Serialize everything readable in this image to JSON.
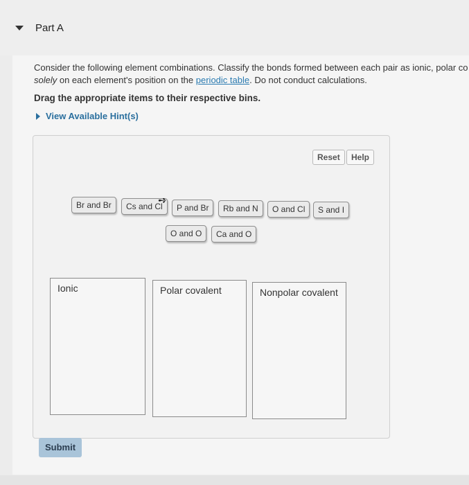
{
  "part": {
    "title": "Part A"
  },
  "question": {
    "line1": "Consider the following element combinations. Classify the bonds formed between each pair as ionic, polar co",
    "line2_italic": "solely",
    "line2_a": " on each element's position on the ",
    "line2_link": "periodic table",
    "line2_b": ". Do not conduct calculations.",
    "instructions": "Drag the appropriate items to their respective bins.",
    "hint": "View Available Hint(s)"
  },
  "toolbar": {
    "reset": "Reset",
    "help": "Help"
  },
  "items": [
    "Br and Br",
    "Cs and Cl",
    "P and Br",
    "Rb and N",
    "O and Cl",
    "S and I",
    "O and O",
    "Ca and O"
  ],
  "bins": {
    "ionic": "Ionic",
    "polar": "Polar covalent",
    "nonpolar": "Nonpolar covalent"
  },
  "submit": "Submit"
}
